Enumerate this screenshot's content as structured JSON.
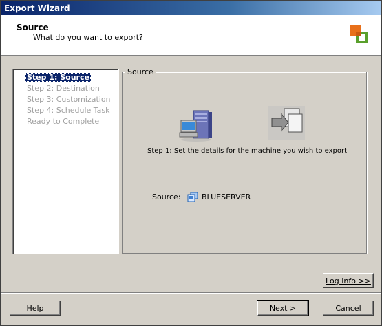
{
  "window": {
    "title": "Export Wizard"
  },
  "header": {
    "title": "Source",
    "subtitle": "What do you want to export?"
  },
  "steps": [
    {
      "label": "Step 1: Source",
      "active": true
    },
    {
      "label": "Step 2: Destination",
      "active": false
    },
    {
      "label": "Step 3: Customization",
      "active": false
    },
    {
      "label": "Step 4: Schedule Task",
      "active": false
    },
    {
      "label": "Ready to Complete",
      "active": false
    }
  ],
  "content": {
    "group_label": "Source",
    "instruction": "Step 1: Set the details for the machine you wish to export",
    "source_label": "Source:",
    "source_value": "BLUESERVER"
  },
  "buttons": {
    "log_info": "Log Info >>",
    "help": "Help",
    "next": "Next >",
    "cancel": "Cancel"
  },
  "colors": {
    "titlebar_start": "#0a246a",
    "titlebar_end": "#a6caf0",
    "dialog_bg": "#d4d0c8",
    "selection": "#0a246a",
    "logo_orange": "#e8701a",
    "logo_green": "#5aa02c"
  }
}
